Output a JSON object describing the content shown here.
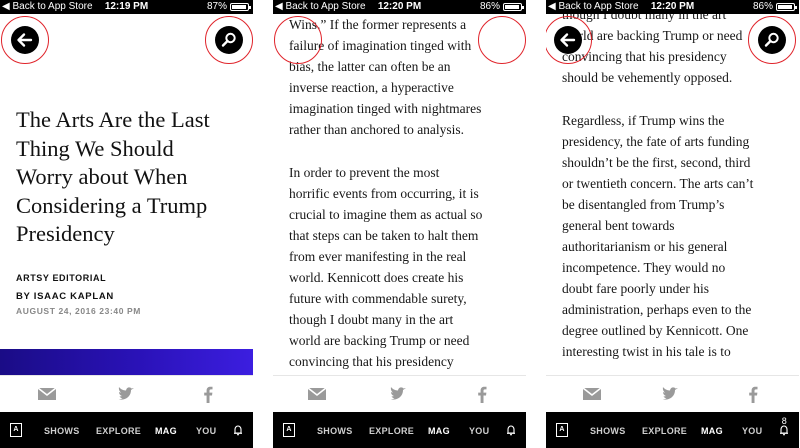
{
  "status_bar": {
    "back_label": "◀ Back to App Store",
    "screens": [
      {
        "time": "12:19 PM",
        "battery": "87%",
        "battery_level": 0.87
      },
      {
        "time": "12:20 PM",
        "battery": "86%",
        "battery_level": 0.86
      },
      {
        "time": "12:20 PM",
        "battery": "86%",
        "battery_level": 0.86
      }
    ]
  },
  "icons": {
    "back": "back-arrow-icon",
    "search": "search-icon",
    "mail": "mail-icon",
    "twitter": "twitter-icon",
    "facebook": "facebook-icon",
    "logo": "artsy-logo-icon",
    "bell": "bell-icon"
  },
  "colors": {
    "accent_ring": "#e0242b",
    "hero_gradient_start": "#1a0c86",
    "hero_gradient_end": "#3c1ee0",
    "nav_background": "#000000"
  },
  "article": {
    "title_lines": [
      "The Arts Are the Last",
      "Thing We Should",
      "Worry about When",
      "Considering a Trump",
      "Presidency"
    ],
    "kicker": "ARTSY EDITORIAL",
    "byline": "BY ISAAC KAPLAN",
    "date": "AUGUST 24, 2016 23:40 PM"
  },
  "screen2": {
    "para1": [
      "Wins.” If the former represents a",
      "failure of imagination tinged with",
      "bias, the latter can often be an",
      "inverse reaction, a hyperactive",
      "imagination tinged with nightmares",
      "rather than anchored to analysis."
    ],
    "para2": [
      "In order to prevent the most",
      "horrific events from occurring, it is",
      "crucial to imagine them as actual so",
      "that steps can be taken to halt them",
      "from ever manifesting in the real",
      "world. Kennicott does create his",
      "future with commendable surety,",
      "though I doubt many in the art",
      "world are backing Trump or need",
      "convincing that his presidency"
    ]
  },
  "screen3": {
    "para1": [
      "though I doubt many in the art",
      "world are backing Trump or need",
      "convincing that his presidency",
      "should be vehemently opposed."
    ],
    "para2": [
      "Regardless, if Trump wins the",
      "presidency, the fate of arts funding",
      "shouldn’t be the first, second, third",
      "or twentieth concern. The arts can’t",
      "be disentangled from Trump’s",
      "general bent towards",
      "authoritarianism or his general",
      "incompetence. They would no",
      "doubt fare poorly under his",
      "administration, perhaps even to the",
      "degree outlined by Kennicott. One",
      "interesting twist in his tale is to"
    ]
  },
  "nav": {
    "logo_label": "A",
    "items": [
      "SHOWS",
      "EXPLORE",
      "MAG",
      "YOU"
    ],
    "active": "MAG",
    "screen3_badge": "8"
  }
}
